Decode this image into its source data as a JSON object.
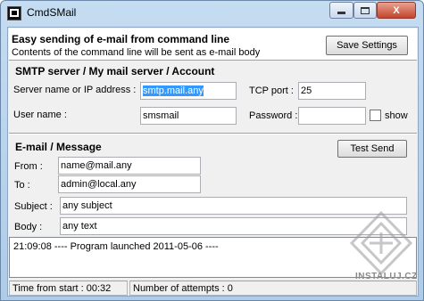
{
  "window": {
    "title": "CmdSMail",
    "close_label": "X"
  },
  "header": {
    "headline": "Easy sending of e-mail from command line",
    "subline": "Contents of the command line will be sent as e-mail body",
    "save_button": "Save Settings"
  },
  "smtp": {
    "section_title": "SMTP server / My mail server / Account",
    "server_label": "Server name or IP address :",
    "server_value": "smtp.mail.any",
    "port_label": "TCP port :",
    "port_value": "25",
    "user_label": "User name :",
    "user_value": "smsmail",
    "password_label": "Password :",
    "password_value": "",
    "show_label": "show",
    "show_checked": false
  },
  "message": {
    "section_title": "E-mail / Message",
    "test_button": "Test Send",
    "from_label": "From :",
    "from_value": "name@mail.any",
    "to_label": "To :",
    "to_value": "admin@local.any",
    "subject_label": "Subject :",
    "subject_value": "any subject",
    "body_label": "Body :",
    "body_value": "any text"
  },
  "log": {
    "lines": [
      "21:09:08  ---- Program launched 2011-05-06 ----"
    ]
  },
  "status": {
    "time_from_start": "Time from start : 00:32",
    "attempts": "Number of attempts : 0"
  },
  "watermark": {
    "text": "INSTALUJ.CZ"
  },
  "colors": {
    "selection": "#3399ff",
    "title_gradient_top": "#c5dcf1",
    "close_button": "#c5432c"
  }
}
